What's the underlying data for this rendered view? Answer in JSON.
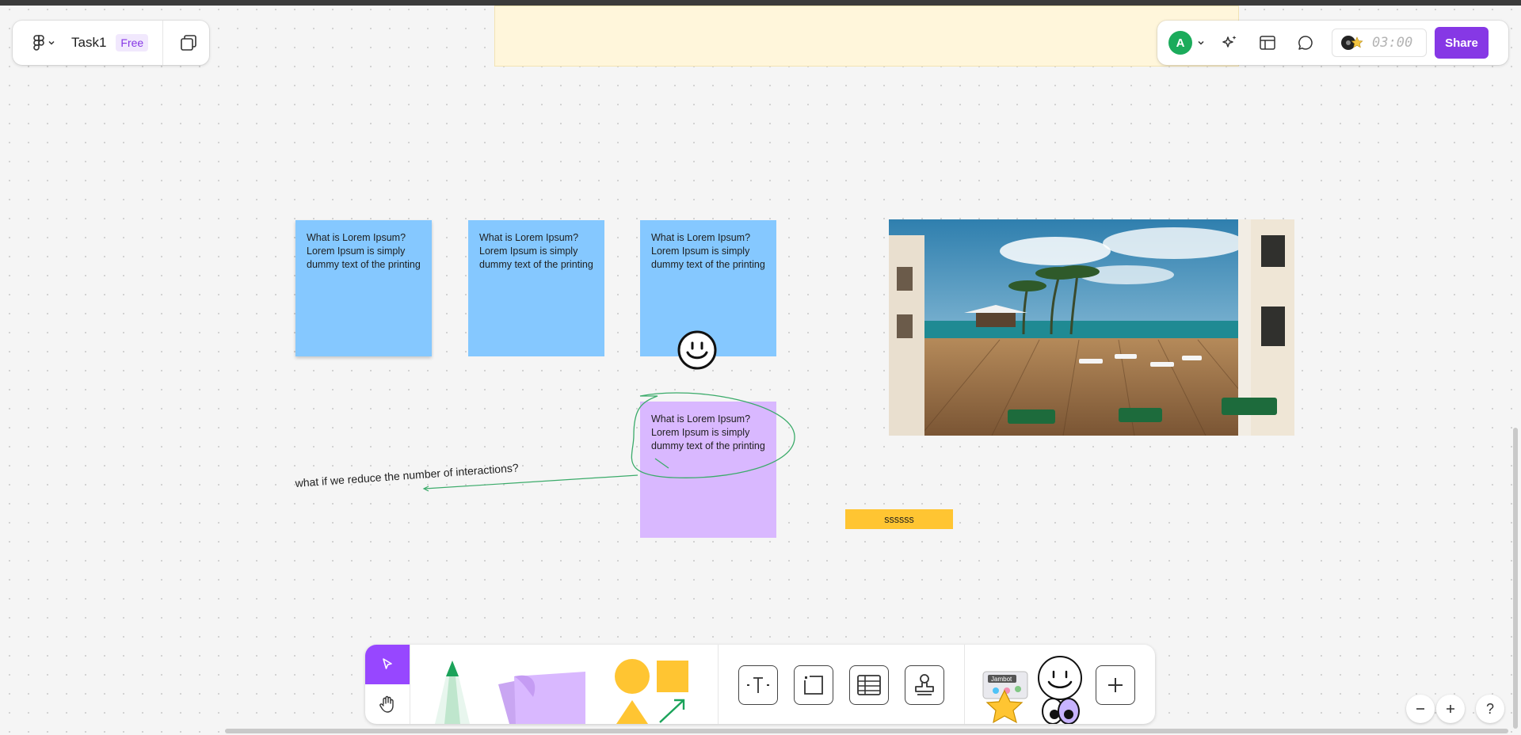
{
  "header": {
    "file_name": "Task1",
    "plan_badge": "Free",
    "avatar_initial": "A",
    "timer": "03:00",
    "share_label": "Share"
  },
  "canvas": {
    "stickies": [
      {
        "text": "What is Lorem Ipsum? Lorem Ipsum is simply dummy text of the printing",
        "color": "#85c8ff"
      },
      {
        "text": "What is Lorem Ipsum? Lorem Ipsum is simply dummy text of the printing",
        "color": "#85c8ff"
      },
      {
        "text": "What is Lorem Ipsum? Lorem Ipsum is simply dummy text of the printing",
        "color": "#85c8ff"
      },
      {
        "text": "What is Lorem Ipsum? Lorem Ipsum is simply dummy text of the printing",
        "color": "#d9b8ff"
      }
    ],
    "handwritten_note": "what if we reduce the number of interactions?",
    "label_pill": "ssssss",
    "stamp_icon": "smiley-face-icon",
    "image": "poolside-deck-photo"
  },
  "toolbar": {
    "tools": [
      "select-tool",
      "hand-tool",
      "marker-tool",
      "sticky-note-tool",
      "shapes-tool",
      "text-tool",
      "section-tool",
      "table-tool",
      "stamp-tool",
      "stickers-tool",
      "more-tool"
    ],
    "sticker_text": "Jambot"
  },
  "zoom": {
    "help": "?"
  },
  "colors": {
    "accent": "#8638e5",
    "select_tool": "#9747ff",
    "blue_sticky": "#85c8ff",
    "violet_sticky": "#d9b8ff",
    "label_yellow": "#ffc532",
    "banner": "#fff6db"
  }
}
